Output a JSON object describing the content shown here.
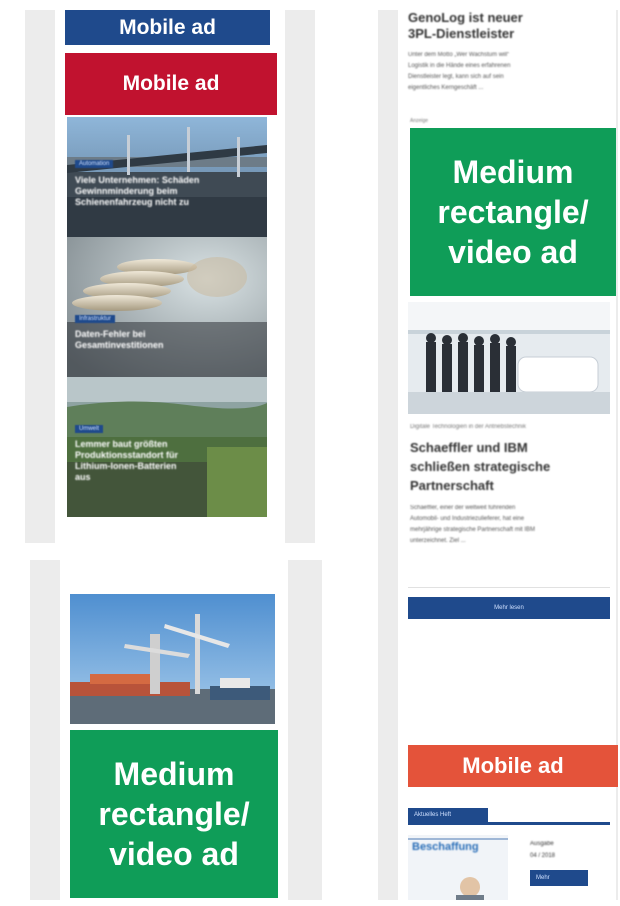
{
  "left_phone_top": {
    "ads": [
      "Mobile ad",
      "Mobile ad"
    ],
    "articles": [
      {
        "badge": "Automation",
        "headline": "Viele Unternehmen: Schäden\nGewinnminderung beim\nSchienenfahrzeug nicht zu"
      },
      {
        "badge": "Infrastruktur",
        "headline": "Daten-Fehler bei\nGesamtinvestitionen"
      },
      {
        "badge": "Umwelt",
        "headline": "Lemmer baut größten\nProduktionsstandort für\nLithium-Ionen-Batterien\naus"
      }
    ]
  },
  "left_phone_bottom": {
    "ad": "Medium\nrectangle/\nvideo ad"
  },
  "right_phone": {
    "top_headline": "GenoLog ist neuer\n3PL-Dienstleister",
    "top_teaser": "Unter dem Motto „Wer Wachstum will“\nLogistik in die Hände eines erfahrenen\nDienstleister legt, kann sich auf sein\neigentliches Kerngeschäft ...",
    "ad_label": "Anzeige",
    "ad_medium": "Medium\nrectangle/\nvideo ad",
    "kicker": "Digitale Technologien in der Antriebstechnik",
    "headline": "Schaeffler und IBM\nschließen strategische\nPartnerschaft",
    "teaser": "Schaeffler, einer der weltweit führenden\nAutomobil- und Industriezulieferer, hat eine\nmehrjährige strategische Partnerschaft mit IBM\nunterzeichnet. Ziel ...",
    "button": "Mehr lesen",
    "ad_mobile": "Mobile ad",
    "issue_tab": "Aktuelles Heft",
    "magazine_title": "Beschaffung",
    "issue_label": "Ausgabe\n04 / 2018",
    "issue_button": "Mehr"
  },
  "colors": {
    "navy": "#1f4a8c",
    "red": "#c1122f",
    "green": "#0f9d58",
    "orange": "#e4533a"
  }
}
